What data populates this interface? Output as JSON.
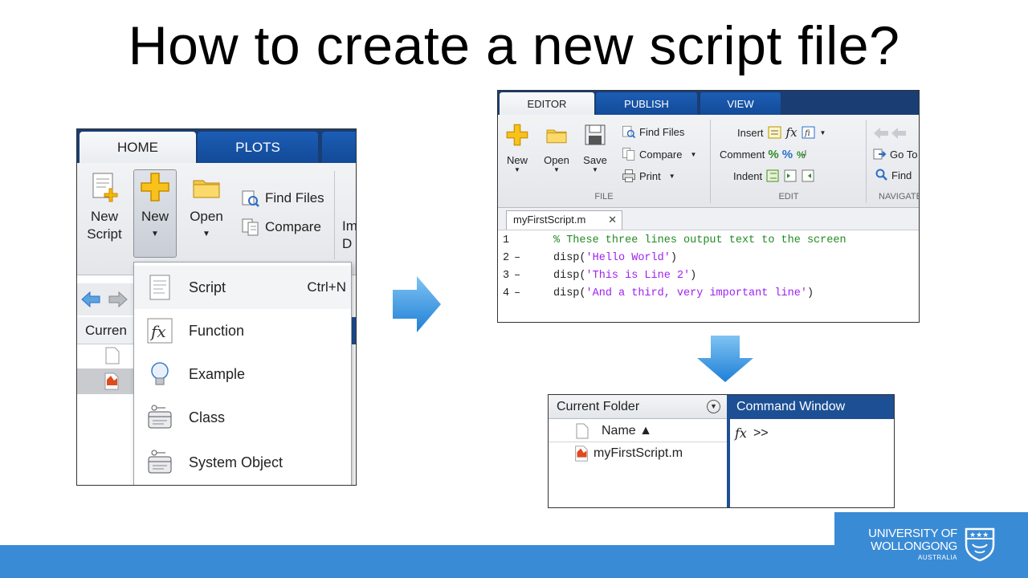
{
  "slide": {
    "title": "How to create a new script file?"
  },
  "home_panel": {
    "tabs": [
      "HOME",
      "PLOTS"
    ],
    "buttons": {
      "new_script_line1": "New",
      "new_script_line2": "Script",
      "new": "New",
      "open": "Open",
      "find_files": "Find Files",
      "compare": "Compare",
      "import_partial_1": "Im",
      "import_partial_2": "D"
    },
    "folder_header": "Curren",
    "new_menu": [
      {
        "label": "Script",
        "shortcut": "Ctrl+N",
        "icon": "script-icon"
      },
      {
        "label": "Function",
        "shortcut": "",
        "icon": "function-icon"
      },
      {
        "label": "Example",
        "shortcut": "",
        "icon": "lightbulb-icon"
      },
      {
        "label": "Class",
        "shortcut": "",
        "icon": "class-icon"
      },
      {
        "label": "System Object",
        "shortcut": "",
        "icon": "system-object-icon"
      }
    ]
  },
  "editor_panel": {
    "tabs": [
      "EDITOR",
      "PUBLISH",
      "VIEW"
    ],
    "file_group": {
      "new": "New",
      "open": "Open",
      "save": "Save",
      "find_files": "Find Files",
      "compare": "Compare",
      "print": "Print",
      "label": "FILE"
    },
    "edit_group": {
      "insert": "Insert",
      "comment": "Comment",
      "indent": "Indent",
      "label": "EDIT"
    },
    "navigate_group": {
      "goto": "Go To",
      "find": "Find",
      "label": "NAVIGATE"
    },
    "file_tab": "myFirstScript.m",
    "code_lines": [
      {
        "num": "1",
        "marker": "",
        "parts": [
          {
            "cls": "c-comment",
            "text": "% These three lines output text to the screen"
          }
        ]
      },
      {
        "num": "2",
        "marker": "–",
        "parts": [
          {
            "cls": "c-fn",
            "text": "disp("
          },
          {
            "cls": "c-str",
            "text": "'Hello World'"
          },
          {
            "cls": "c-fn",
            "text": ")"
          }
        ]
      },
      {
        "num": "3",
        "marker": "–",
        "parts": [
          {
            "cls": "c-fn",
            "text": "disp("
          },
          {
            "cls": "c-str",
            "text": "'This is Line 2'"
          },
          {
            "cls": "c-fn",
            "text": ")"
          }
        ]
      },
      {
        "num": "4",
        "marker": "–",
        "parts": [
          {
            "cls": "c-fn",
            "text": "disp("
          },
          {
            "cls": "c-str",
            "text": "'And a third, very important line'"
          },
          {
            "cls": "c-fn",
            "text": ")"
          }
        ]
      }
    ]
  },
  "command_panel": {
    "current_folder": "Current Folder",
    "name_col": "Name ▲",
    "file": "myFirstScript.m",
    "command_window": "Command Window",
    "prompt": ">>"
  },
  "footer": {
    "logo_line1": "UNIVERSITY OF",
    "logo_line2": "WOLLONGONG",
    "logo_line3": "AUSTRALIA"
  },
  "colors": {
    "matlab_blue": "#1a3d73",
    "tab_blue": "#1c5db5",
    "footer_blue": "#3a8bd6",
    "comment_green": "#228b22",
    "string_purple": "#a020f0"
  }
}
